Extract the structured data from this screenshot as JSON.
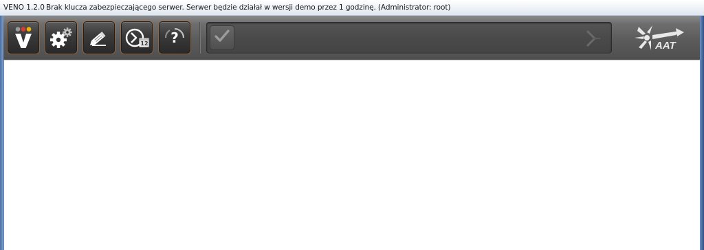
{
  "window": {
    "app_title": "VENO 1.2.0",
    "status_message": "Brak klucza zabezpieczającego serwer. Serwer będzie działał w wersji demo przez 1 godzinę. (Administrator: root)"
  },
  "toolbar": {
    "buttons": [
      {
        "name": "veno-home-button",
        "icon": "veno-logo-icon"
      },
      {
        "name": "settings-button",
        "icon": "gears-icon"
      },
      {
        "name": "edit-button",
        "icon": "pencil-icon"
      },
      {
        "name": "schedule-button",
        "icon": "clock-calendar-icon",
        "badge": "12"
      },
      {
        "name": "help-button",
        "icon": "question-icon",
        "glyph": "?"
      }
    ],
    "status_panel": {
      "check_icon": "checkmark-icon",
      "arrow_icon": "chevron-right-icon"
    },
    "brand_logo": {
      "icon": "aat-logo-icon",
      "text": "AAT"
    }
  },
  "colors": {
    "toolbar_dark": "#3b3b3b",
    "button_glow": "#be6e28",
    "logo_red": "#e03a2f",
    "logo_yellow": "#f0b400",
    "logo_gray": "#9a9a9a"
  }
}
